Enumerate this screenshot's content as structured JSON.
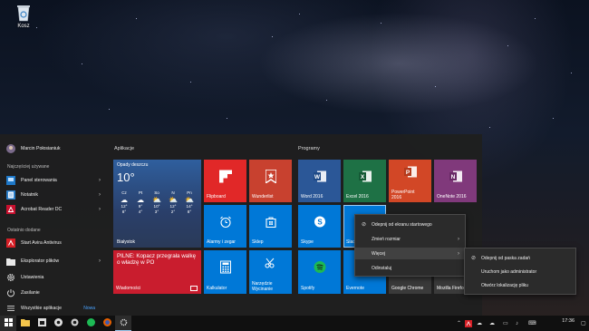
{
  "desktop": {
    "recycle_bin_label": "Kosz"
  },
  "user": {
    "name": "Marcin Połosianiuk"
  },
  "left": {
    "most_used_title": "Najczęściej używane",
    "most_used": [
      {
        "label": "Panel sterowania",
        "icon": "control-panel-icon",
        "has_arrow": true
      },
      {
        "label": "Notatnik",
        "icon": "notepad-icon",
        "has_arrow": true
      },
      {
        "label": "Acrobat Reader DC",
        "icon": "acrobat-icon",
        "has_arrow": true
      }
    ],
    "recent_title": "Ostatnio dodane",
    "recent": [
      {
        "label": "Start Avira Antivirus",
        "icon": "avira-icon"
      }
    ],
    "bottom": [
      {
        "label": "Eksplorator plików",
        "icon": "file-explorer-icon",
        "has_arrow": true
      },
      {
        "label": "Ustawienia",
        "icon": "gear-icon"
      },
      {
        "label": "Zasilanie",
        "icon": "power-icon"
      },
      {
        "label": "Wszystkie aplikacje",
        "icon": "all-apps-icon",
        "badge": "Nowa"
      }
    ]
  },
  "groups": {
    "apps": "Aplikacje",
    "programs": "Programy"
  },
  "tiles": {
    "weather": {
      "condition": "Opady deszczu",
      "temp": "10°",
      "city": "Białystok",
      "days": [
        {
          "name": "Cz",
          "icon": "cloud-icon",
          "hi": "12°",
          "lo": "8°"
        },
        {
          "name": "Pt",
          "icon": "cloud-icon",
          "hi": "9°",
          "lo": "4°"
        },
        {
          "name": "So",
          "icon": "partly-cloudy-icon",
          "hi": "10°",
          "lo": "3°"
        },
        {
          "name": "N",
          "icon": "partly-cloudy-icon",
          "hi": "12°",
          "lo": "2°"
        },
        {
          "name": "Pn",
          "icon": "partly-cloudy-icon",
          "hi": "14°",
          "lo": "8°"
        }
      ]
    },
    "news": {
      "headline": "PILNE: Kopacz przegrała walkę o władzę w PO",
      "label": "Wiadomości"
    },
    "flipboard": "Flipboard",
    "wunderlist": "Wunderlist",
    "alarms": "Alarmy i zegar",
    "store": "Sklep",
    "calculator": "Kalkulator",
    "snipping": "Narzędzie Wycinanie",
    "word": "Word 2016",
    "excel": "Excel 2016",
    "powerpoint": "PowerPoint 2016",
    "onenote": "OneNote 2016",
    "skype": "Skype",
    "slack": "Slac",
    "spotify": "Spotify",
    "evernote": "Evernote",
    "chrome": "Google Chrome",
    "firefox": "Mozilla Firefo"
  },
  "context_menu": {
    "items": [
      {
        "label": "Odepnij od ekranu startowego",
        "icon": "unpin-icon"
      },
      {
        "label": "Zmień rozmiar",
        "has_arrow": true
      },
      {
        "label": "Więcej",
        "has_arrow": true,
        "highlighted": true
      },
      {
        "label": "Odinstaluj"
      }
    ]
  },
  "submenu": {
    "items": [
      {
        "label": "Odepnij od paska zadań",
        "icon": "unpin-icon"
      },
      {
        "label": "Uruchom jako administrator"
      },
      {
        "label": "Otwórz lokalizację pliku"
      }
    ]
  },
  "taskbar": {
    "time": "17:36"
  },
  "colors": {
    "start_bg": "#1f1f1f",
    "tile_blue": "#0078d7",
    "flipboard": "#e12828",
    "wunderlist": "#c8412f",
    "news": "#c91d2e",
    "word": "#2b5797",
    "excel": "#1e7145",
    "powerpoint": "#d24726",
    "onenote": "#80397b",
    "accent_link": "#4aa3ff"
  }
}
